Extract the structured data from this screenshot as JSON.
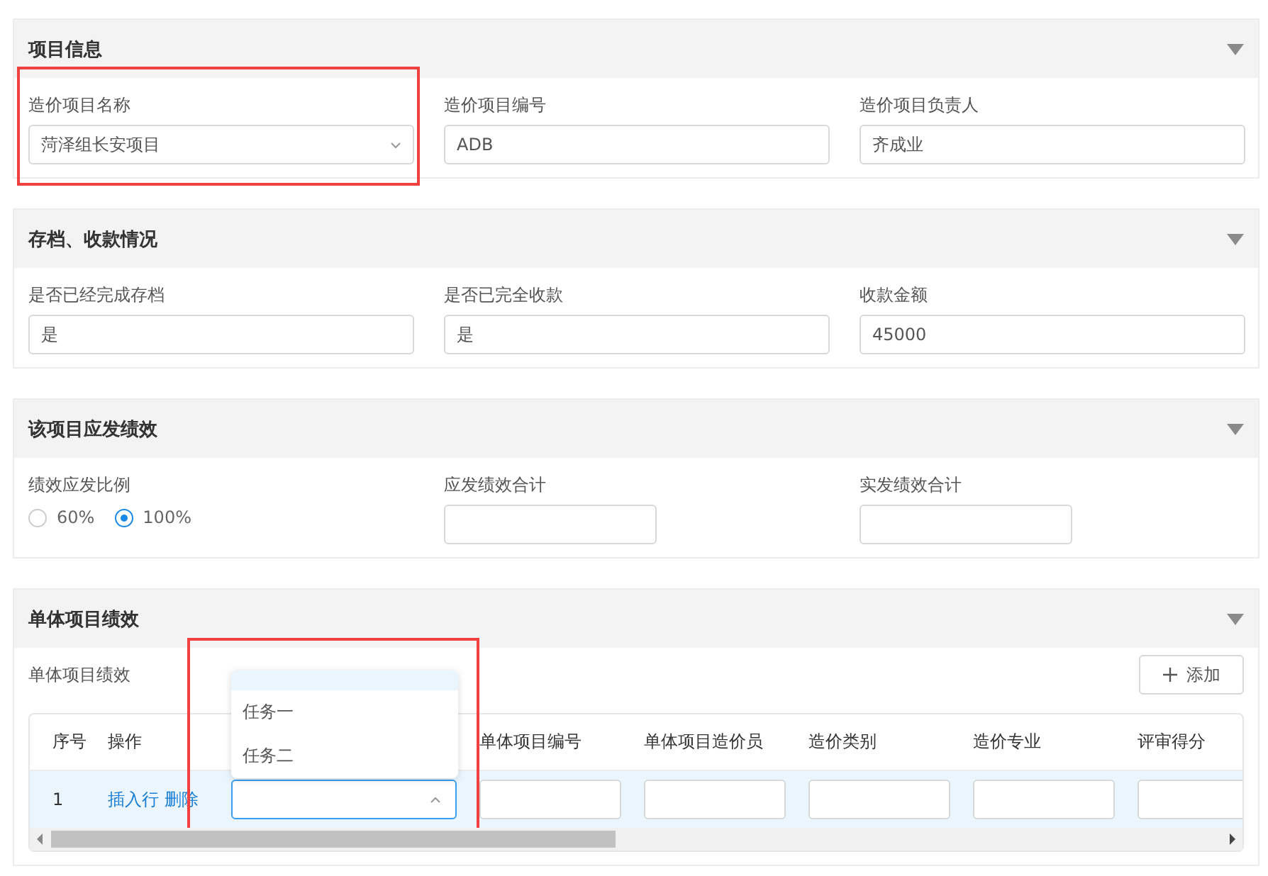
{
  "sections": [
    {
      "title": "项目信息",
      "expanded": true,
      "fields": [
        {
          "kind": "select",
          "label": "造价项目名称",
          "value": "菏泽组长安项目",
          "highlighted": true
        },
        {
          "kind": "text",
          "label": "造价项目编号",
          "value": "ADB"
        },
        {
          "kind": "text",
          "label": "造价项目负责人",
          "value": "齐成业"
        }
      ]
    },
    {
      "title": "存档、收款情况",
      "expanded": true,
      "fields": [
        {
          "kind": "text",
          "label": "是否已经完成存档",
          "value": "是"
        },
        {
          "kind": "text",
          "label": "是否已完全收款",
          "value": "是"
        },
        {
          "kind": "text",
          "label": "收款金额",
          "value": "45000"
        }
      ]
    },
    {
      "title": "该项目应发绩效",
      "expanded": true,
      "fields": [
        {
          "kind": "radio",
          "label": "绩效应发比例",
          "options": [
            {
              "label": "60%",
              "selected": false
            },
            {
              "label": "100%",
              "selected": true
            }
          ]
        },
        {
          "kind": "short",
          "label": "应发绩效合计"
        },
        {
          "kind": "short",
          "label": "实发绩效合计"
        }
      ]
    },
    {
      "title": "单体项目绩效",
      "expanded": true,
      "kind": "table",
      "subtitle": "单体项目绩效",
      "add_button": "添加",
      "table": {
        "columns": [
          "序号",
          "操作",
          null,
          "单体项目编号",
          "单体项目造价员",
          "造价类别",
          "造价专业",
          "评审得分"
        ],
        "rows": [
          {
            "index": "1",
            "actions": [
              "插入行",
              "删除"
            ],
            "selected": true
          }
        ],
        "dropdown": {
          "open": true,
          "highlighted": true,
          "options": [
            {
              "label": "任务一",
              "selected": false
            },
            {
              "label": "任务二",
              "selected": false
            }
          ]
        }
      }
    }
  ]
}
